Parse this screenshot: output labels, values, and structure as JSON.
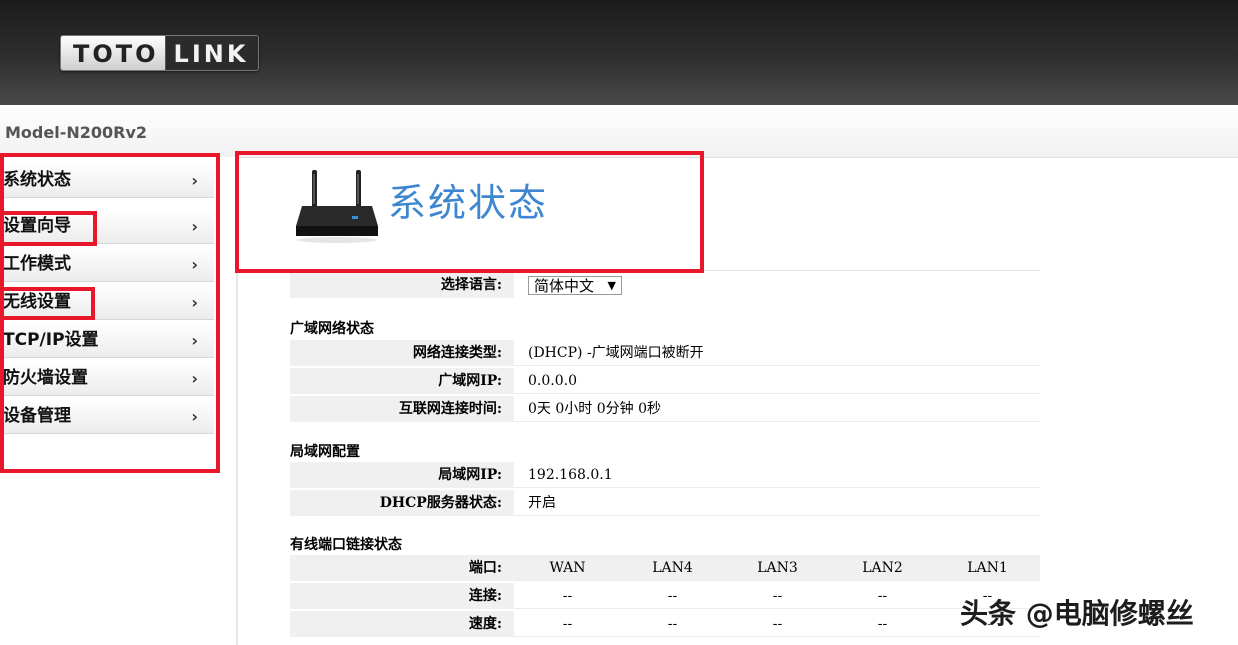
{
  "brand": {
    "logo_left": "TOTO",
    "logo_right": "LINK",
    "model": "Model-N200Rv2"
  },
  "sidebar": {
    "items": [
      {
        "label": "系统状态"
      },
      {
        "label": "设置向导"
      },
      {
        "label": "工作模式"
      },
      {
        "label": "无线设置"
      },
      {
        "label": "TCP/IP设置"
      },
      {
        "label": "防火墙设置"
      },
      {
        "label": "设备管理"
      }
    ],
    "arrow": "›"
  },
  "page": {
    "title": "系统状态"
  },
  "language": {
    "label": "选择语言:",
    "selected": "简体中文"
  },
  "wan": {
    "section": "广域网络状态",
    "rows": [
      {
        "label": "网络连接类型:",
        "value": "(DHCP) -广域网端口被断开"
      },
      {
        "label": "广域网IP:",
        "value": "0.0.0.0"
      },
      {
        "label": "互联网连接时间:",
        "value": "0天 0小时 0分钟 0秒"
      }
    ]
  },
  "lan": {
    "section": "局域网配置",
    "rows": [
      {
        "label": "局域网IP:",
        "value": "192.168.0.1"
      },
      {
        "label": "DHCP服务器状态:",
        "value": "开启"
      }
    ]
  },
  "ports": {
    "section": "有线端口链接状态",
    "header_label": "端口:",
    "columns": [
      "WAN",
      "LAN4",
      "LAN3",
      "LAN2",
      "LAN1"
    ],
    "rows": [
      {
        "label": "连接:",
        "values": [
          "--",
          "--",
          "--",
          "--",
          "--"
        ]
      },
      {
        "label": "速度:",
        "values": [
          "--",
          "--",
          "--",
          "--",
          "--"
        ]
      }
    ]
  },
  "watermark": "头条 @电脑修螺丝",
  "colors": {
    "annotation_red": "#e8182a",
    "title_blue": "#3f86d1"
  }
}
